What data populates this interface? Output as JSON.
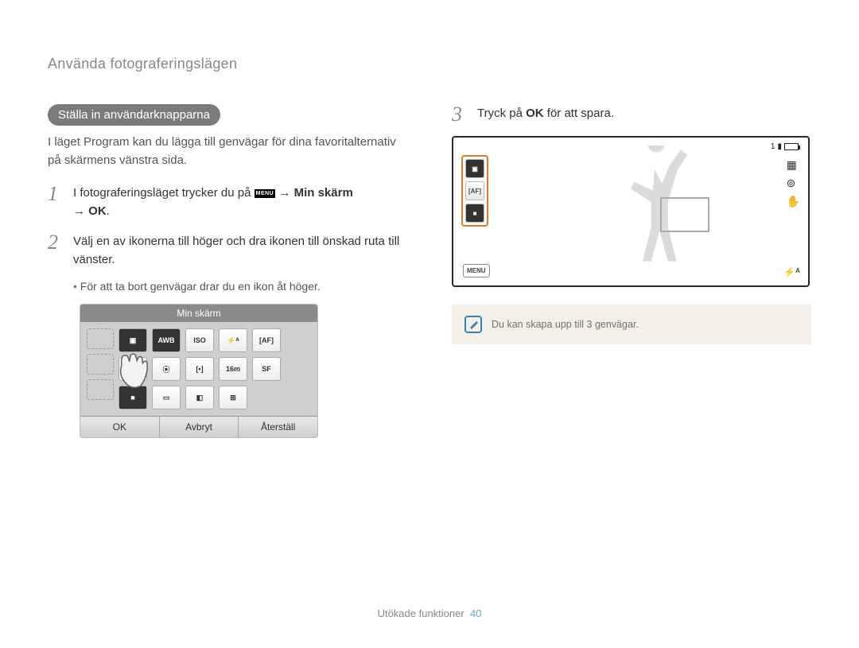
{
  "header": "Använda fotograferingslägen",
  "pill": "Ställa in användarknapparna",
  "intro": "I läget Program kan du lägga till genvägar för dina favoritalternativ på skärmens vänstra sida.",
  "steps": {
    "s1_num": "1",
    "s1_prefix": "I fotograferingsläget trycker du på ",
    "s1_menu_icon_label": "MENU",
    "s1_arrow1": "→",
    "s1_mid": "Min skärm",
    "s1_arrow2": "→",
    "s1_end": "OK",
    "s2_num": "2",
    "s2_text": "Välj en av ikonerna till höger och dra ikonen till önskad ruta till vänster.",
    "s2_bullet": "För att ta bort genvägar drar du en ikon åt höger.",
    "s3_num": "3",
    "s3_prefix": "Tryck på ",
    "s3_bold": "OK",
    "s3_suffix": " för att spara."
  },
  "mini": {
    "title": "Min skärm",
    "btn_ok": "OK",
    "btn_cancel": "Avbryt",
    "btn_reset": "Återställ",
    "icons": [
      "▣",
      "AWB",
      "ISO",
      "⚡ᴬ",
      "[AF]",
      "▢",
      "⦿",
      "[•]",
      "16m",
      "SF",
      "■",
      "▭",
      "◧",
      "⊞",
      ""
    ]
  },
  "preview": {
    "side_icons": [
      "▣",
      "[AF]",
      "■"
    ],
    "menu": "MENU",
    "status_count": "1",
    "right_icons": [
      "▦",
      "⊚",
      "✋"
    ],
    "flash": "⚡ᴬ"
  },
  "note": "Du kan skapa upp till 3 genvägar.",
  "footer_label": "Utökade funktioner",
  "footer_page": "40"
}
